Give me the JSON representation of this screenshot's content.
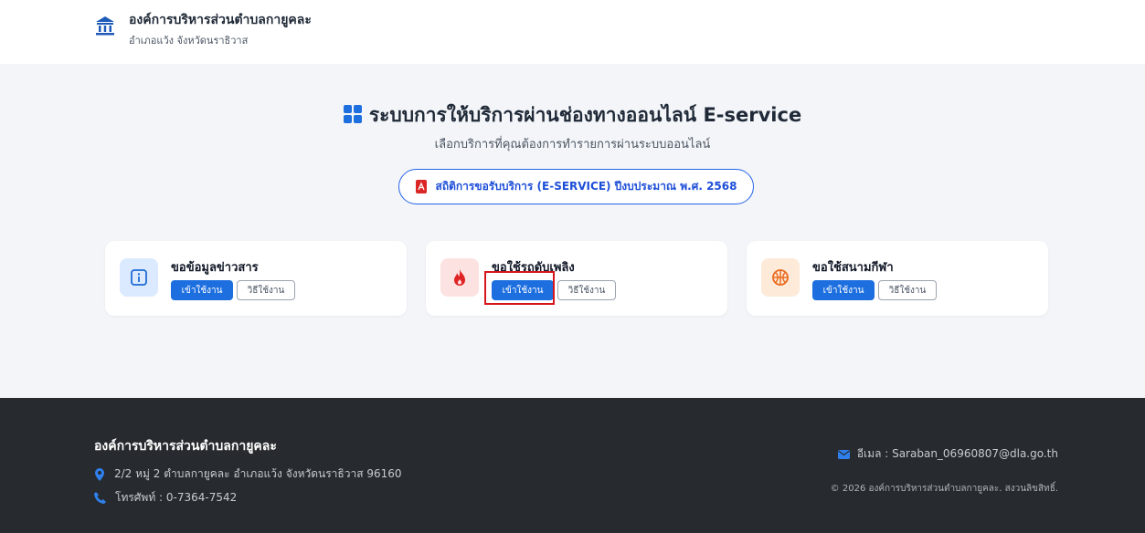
{
  "header": {
    "org_name": "องค์การบริหารส่วนตำบลกายูคละ",
    "org_sub": "อำเภอแว้ง จังหวัดนราธิวาส",
    "logo_icon": "building-columns-icon"
  },
  "hero": {
    "title": "ระบบการให้บริการผ่านช่องทางออนไลน์ E-service",
    "subtitle": "เลือกบริการที่คุณต้องการทำรายการผ่านระบบออนไลน์",
    "stats_button": "สถิติการขอรับบริการ (E-SERVICE) ปีงบประมาณ พ.ศ. 2568",
    "title_icon": "grid-icon",
    "stats_icon": "pdf-icon"
  },
  "services": [
    {
      "title": "ขอข้อมูลข่าวสาร",
      "enter": "เข้าใช้งาน",
      "howto": "วิธีใช้งาน",
      "icon": "info-icon",
      "icon_bg": "#dbeafe",
      "icon_color": "#1e6bd6"
    },
    {
      "title": "ขอใช้รถดับเพลิง",
      "enter": "เข้าใช้งาน",
      "howto": "วิธีใช้งาน",
      "icon": "fire-icon",
      "icon_bg": "#fde2e2",
      "icon_color": "#e02424"
    },
    {
      "title": "ขอใช้สนามกีฬา",
      "enter": "เข้าใช้งาน",
      "howto": "วิธีใช้งาน",
      "icon": "basketball-icon",
      "icon_bg": "#feead9",
      "icon_color": "#ea6a1f"
    }
  ],
  "footer": {
    "org_name": "องค์การบริหารส่วนตำบลกายูคละ",
    "address": "2/2 หมู่ 2 ตำบลกายูคละ อำเภอแว้ง จังหวัดนราธิวาส 96160",
    "phone": "โทรศัพท์ : 0-7364-7542",
    "email": "อีเมล : Saraban_06960807@dla.go.th",
    "copyright": "© 2026 องค์การบริหารส่วนตำบลกายูคละ. สงวนลิขสิทธิ์."
  },
  "colors": {
    "primary": "#1d6fe0",
    "footer_bg": "#272a2e",
    "highlight": "#d6161d"
  }
}
